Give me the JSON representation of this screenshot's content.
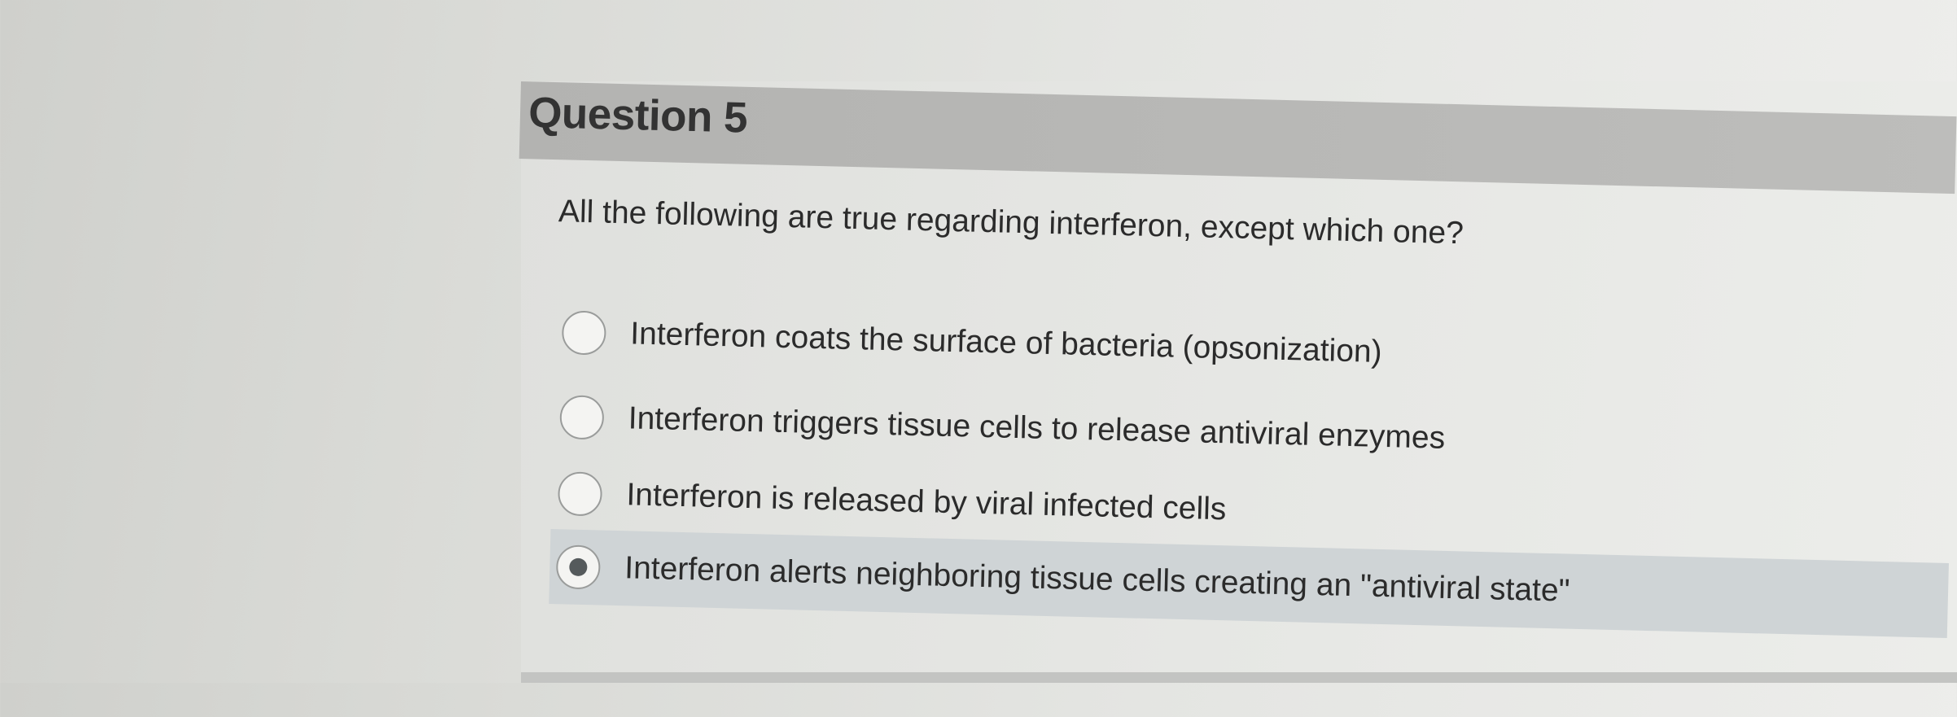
{
  "question": {
    "title": "Question 5",
    "prompt": "All the following are true regarding interferon, except which one?"
  },
  "options": [
    {
      "label": "Interferon coats the surface of bacteria (opsonization)",
      "selected": false
    },
    {
      "label": "Interferon triggers tissue cells to release antiviral enzymes",
      "selected": false
    },
    {
      "label": "Interferon is released by viral infected cells",
      "selected": false
    },
    {
      "label": "Interferon alerts neighboring tissue cells creating an \"antiviral state\"",
      "selected": true
    }
  ],
  "colors": {
    "header_bg": "#b6b6b4",
    "selected_row_bg": "#cfd4d6",
    "radio_dot": "#555a5c",
    "text": "#2b2b2b"
  }
}
